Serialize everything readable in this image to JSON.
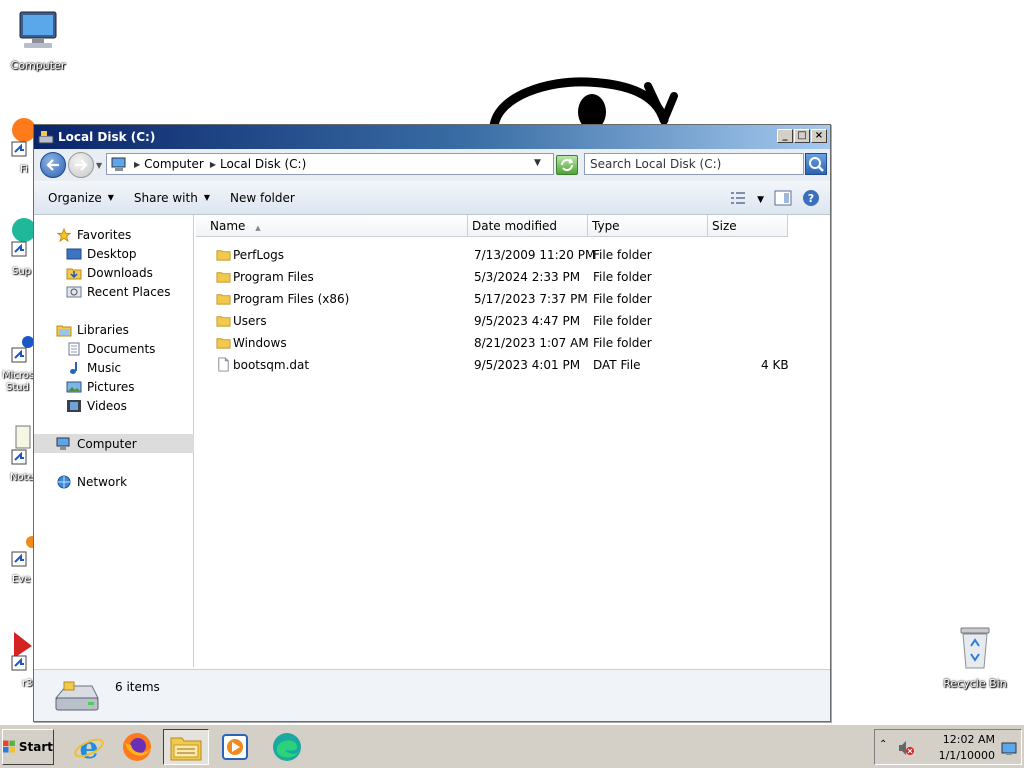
{
  "desktop": {
    "computer_label": "Computer",
    "recycle_label": "Recycle Bin",
    "side_labels": [
      "Fi",
      "Sup",
      "Micros",
      "Stud",
      "Note",
      "Eve",
      "r3"
    ]
  },
  "window": {
    "title": "Local Disk (C:)",
    "controls": {
      "minimize": "_",
      "maximize": "□",
      "close": "×"
    }
  },
  "address": {
    "crumbs": [
      "Computer",
      "Local Disk (C:)"
    ],
    "search_placeholder": "Search Local Disk (C:)"
  },
  "toolbar": {
    "organize": "Organize",
    "share_with": "Share with",
    "new_folder": "New folder"
  },
  "navpane": {
    "favorites": "Favorites",
    "desktop": "Desktop",
    "downloads": "Downloads",
    "recent_places": "Recent Places",
    "libraries": "Libraries",
    "documents": "Documents",
    "music": "Music",
    "pictures": "Pictures",
    "videos": "Videos",
    "computer": "Computer",
    "network": "Network"
  },
  "columns": {
    "name": "Name",
    "date": "Date modified",
    "type": "Type",
    "size": "Size"
  },
  "files": [
    {
      "name": "PerfLogs",
      "date": "7/13/2009 11:20 PM",
      "type": "File folder",
      "size": ""
    },
    {
      "name": "Program Files",
      "date": "5/3/2024 2:33 PM",
      "type": "File folder",
      "size": ""
    },
    {
      "name": "Program Files (x86)",
      "date": "5/17/2023 7:37 PM",
      "type": "File folder",
      "size": ""
    },
    {
      "name": "Users",
      "date": "9/5/2023 4:47 PM",
      "type": "File folder",
      "size": ""
    },
    {
      "name": "Windows",
      "date": "8/21/2023 1:07 AM",
      "type": "File folder",
      "size": ""
    },
    {
      "name": "bootsqm.dat",
      "date": "9/5/2023 4:01 PM",
      "type": "DAT File",
      "size": "4 KB"
    }
  ],
  "status": {
    "item_count": "6 items"
  },
  "taskbar": {
    "start": "Start",
    "apps": [
      "internet-explorer-icon",
      "firefox-icon",
      "explorer-icon",
      "media-player-icon",
      "edge-icon"
    ]
  },
  "clock": {
    "time": "12:02 AM",
    "date": "1/1/10000"
  }
}
